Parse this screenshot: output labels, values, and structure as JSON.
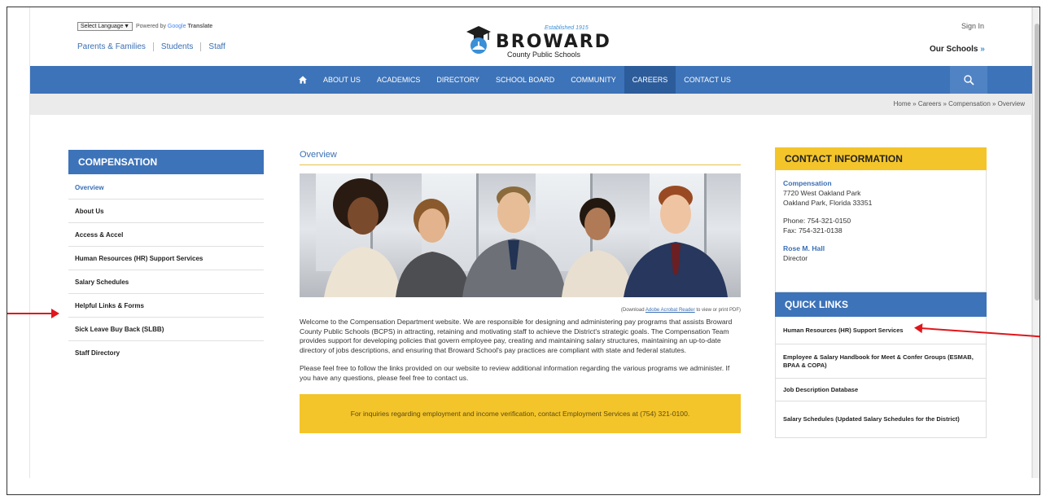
{
  "header": {
    "language_select": "Select Language",
    "powered_by": "Powered by",
    "google": "Google",
    "translate": "Translate",
    "audience_links": [
      "Parents & Families",
      "Students",
      "Staff"
    ],
    "logo_established": "Established 1915",
    "logo_name": "BROWARD",
    "logo_subtitle": "County Public Schools",
    "sign_in": "Sign In",
    "our_schools": "Our Schools",
    "our_schools_chevron": "»"
  },
  "nav": {
    "items": [
      "ABOUT US",
      "ACADEMICS",
      "DIRECTORY",
      "SCHOOL BOARD",
      "COMMUNITY",
      "CAREERS",
      "CONTACT US"
    ],
    "active": "CAREERS",
    "icons": [
      "home-icon",
      "search-icon"
    ]
  },
  "breadcrumb": "Home » Careers » Compensation » Overview",
  "sidebar": {
    "title": "COMPENSATION",
    "items": [
      "Overview",
      "About Us",
      "Access & Accel",
      "Human Resources (HR) Support Services",
      "Salary Schedules",
      "Helpful Links & Forms",
      "Sick Leave Buy Back (SLBB)",
      "Staff Directory"
    ],
    "current": "Overview"
  },
  "main": {
    "title": "Overview",
    "pdf_prefix": "(Download",
    "pdf_link": "Adobe Acrobat Reader",
    "pdf_suffix": "to view or print PDF)",
    "paragraph1": "Welcome to the Compensation Department website.  We are responsible for designing and administering pay programs that assists Broward County Public Schools (BCPS) in attracting, retaining and motivating staff to achieve the District's strategic goals. The Compensation Team provides support for developing policies that govern employee pay, creating and maintaining salary structures, maintaining an up-to-date directory of jobs descriptions, and ensuring that Broward School's pay practices are compliant with state and federal statutes.",
    "paragraph2": "Please feel free to follow the links provided on our website to review additional information regarding the various programs we administer. If you have any questions, please feel free to contact us.",
    "notice": "For inquiries regarding employment and income verification, contact Employment Services at (754) 321-0100."
  },
  "contact": {
    "title": "CONTACT INFORMATION",
    "dept": "Compensation",
    "address1": "7720 West Oakland Park",
    "address2": "Oakland Park, Florida 33351",
    "phone": "Phone: 754-321-0150",
    "fax": "Fax: 754-321-0138",
    "person": "Rose M. Hall",
    "role": "Director"
  },
  "quick_links": {
    "title": "QUICK LINKS",
    "items": [
      "Human Resources (HR) Support Services",
      "Employee & Salary Handbook for Meet & Confer Groups (ESMAB, BPAA & COPA)",
      "Job Description Database",
      "Salary Schedules (Updated Salary Schedules for the District)"
    ]
  },
  "colors": {
    "nav_blue": "#3d73b8",
    "gold": "#f4c52a",
    "link_blue": "#3a6fb5",
    "annotation_red": "#e0161b"
  }
}
